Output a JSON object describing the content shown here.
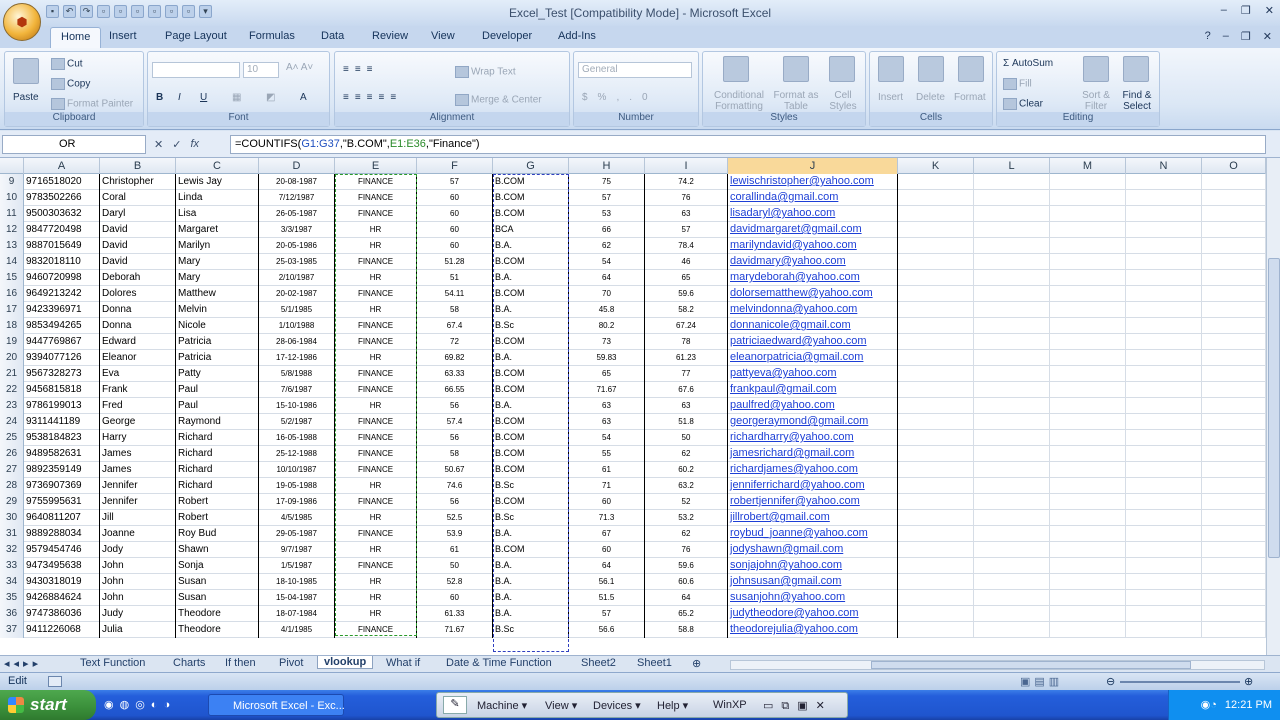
{
  "window": {
    "title": "Excel_Test  [Compatibility Mode] - Microsoft Excel",
    "controls": [
      "–",
      "❐",
      "✕"
    ]
  },
  "ribbon_tabs": [
    "Home",
    "Insert",
    "Page Layout",
    "Formulas",
    "Data",
    "Review",
    "View",
    "Developer",
    "Add-Ins"
  ],
  "ribbon": {
    "clipboard": {
      "paste": "Paste",
      "cut": "Cut",
      "copy": "Copy",
      "format_painter": "Format Painter",
      "label": "Clipboard"
    },
    "font": {
      "font_size": "10",
      "label": "Font"
    },
    "alignment": {
      "wrap": "Wrap Text",
      "merge": "Merge & Center",
      "label": "Alignment"
    },
    "number": {
      "format": "General",
      "label": "Number"
    },
    "styles": {
      "cond": "Conditional Formatting",
      "table": "Format as Table",
      "cell": "Cell Styles",
      "label": "Styles"
    },
    "cells": {
      "insert": "Insert",
      "delete": "Delete",
      "format": "Format",
      "label": "Cells"
    },
    "editing": {
      "autosum": "AutoSum",
      "fill": "Fill",
      "clear": "Clear",
      "sort": "Sort & Filter",
      "find": "Find & Select",
      "label": "Editing"
    }
  },
  "formula_bar": {
    "name_box": "OR",
    "fx": "fx",
    "formula_prefix": "=COUNTIFS(",
    "range1": "G1:G37",
    "crit1": ",\"B.COM\",",
    "range2": "E1:E36",
    "crit2": ",\"Finance\")"
  },
  "columns": [
    "A",
    "B",
    "C",
    "D",
    "E",
    "F",
    "G",
    "H",
    "I",
    "J",
    "K",
    "L",
    "M",
    "N",
    "O"
  ],
  "rows": [
    {
      "n": "9",
      "a": "9716518020",
      "b": "Christopher",
      "c": "Lewis Jay",
      "d": "20-08-1987",
      "e": "FINANCE",
      "f": "57",
      "g": "B.COM",
      "h": "75",
      "i": "74.2",
      "j": "lewischristopher@yahoo.com"
    },
    {
      "n": "10",
      "a": "9783502266",
      "b": "Coral",
      "c": "Linda",
      "d": "7/12/1987",
      "e": "FINANCE",
      "f": "60",
      "g": "B.COM",
      "h": "57",
      "i": "76",
      "j": "corallinda@gmail.com"
    },
    {
      "n": "11",
      "a": "9500303632",
      "b": "Daryl",
      "c": "Lisa",
      "d": "26-05-1987",
      "e": "FINANCE",
      "f": "60",
      "g": "B.COM",
      "h": "53",
      "i": "63",
      "j": "lisadaryl@yahoo.com"
    },
    {
      "n": "12",
      "a": "9847720498",
      "b": "David",
      "c": "Margaret",
      "d": "3/3/1987",
      "e": "HR",
      "f": "60",
      "g": "BCA",
      "h": "66",
      "i": "57",
      "j": "davidmargaret@gmail.com"
    },
    {
      "n": "13",
      "a": "9887015649",
      "b": "David",
      "c": "Marilyn",
      "d": "20-05-1986",
      "e": "HR",
      "f": "60",
      "g": "B.A.",
      "h": "62",
      "i": "78.4",
      "j": "marilyndavid@yahoo.com"
    },
    {
      "n": "14",
      "a": "9832018110",
      "b": "David",
      "c": "Mary",
      "d": "25-03-1985",
      "e": "FINANCE",
      "f": "51.28",
      "g": "B.COM",
      "h": "54",
      "i": "46",
      "j": "davidmary@yahoo.com"
    },
    {
      "n": "15",
      "a": "9460720998",
      "b": "Deborah",
      "c": "Mary",
      "d": "2/10/1987",
      "e": "HR",
      "f": "51",
      "g": "B.A.",
      "h": "64",
      "i": "65",
      "j": "marydeborah@yahoo.com"
    },
    {
      "n": "16",
      "a": "9649213242",
      "b": "Dolores",
      "c": "Matthew",
      "d": "20-02-1987",
      "e": "FINANCE",
      "f": "54.11",
      "g": "B.COM",
      "h": "70",
      "i": "59.6",
      "j": "dolorsematthew@yahoo.com"
    },
    {
      "n": "17",
      "a": "9423396971",
      "b": "Donna",
      "c": "Melvin",
      "d": "5/1/1985",
      "e": "HR",
      "f": "58",
      "g": "B.A.",
      "h": "45.8",
      "i": "58.2",
      "j": "melvindonna@yahoo.com"
    },
    {
      "n": "18",
      "a": "9853494265",
      "b": "Donna",
      "c": "Nicole",
      "d": "1/10/1988",
      "e": "FINANCE",
      "f": "67.4",
      "g": "B.Sc",
      "h": "80.2",
      "i": "67.24",
      "j": "donnanicole@gmail.com"
    },
    {
      "n": "19",
      "a": "9447769867",
      "b": "Edward",
      "c": "Patricia",
      "d": "28-06-1984",
      "e": "FINANCE",
      "f": "72",
      "g": "B.COM",
      "h": "73",
      "i": "78",
      "j": "patriciaedward@yahoo.com"
    },
    {
      "n": "20",
      "a": "9394077126",
      "b": "Eleanor",
      "c": "Patricia",
      "d": "17-12-1986",
      "e": "HR",
      "f": "69.82",
      "g": "B.A.",
      "h": "59.83",
      "i": "61.23",
      "j": "eleanorpatricia@gmail.com"
    },
    {
      "n": "21",
      "a": "9567328273",
      "b": "Eva",
      "c": "Patty",
      "d": "5/8/1988",
      "e": "FINANCE",
      "f": "63.33",
      "g": "B.COM",
      "h": "65",
      "i": "77",
      "j": "pattyeva@yahoo.com"
    },
    {
      "n": "22",
      "a": "9456815818",
      "b": "Frank",
      "c": "Paul",
      "d": "7/6/1987",
      "e": "FINANCE",
      "f": "66.55",
      "g": "B.COM",
      "h": "71.67",
      "i": "67.6",
      "j": "frankpaul@gmail.com"
    },
    {
      "n": "23",
      "a": "9786199013",
      "b": "Fred",
      "c": "Paul",
      "d": "15-10-1986",
      "e": "HR",
      "f": "56",
      "g": "B.A.",
      "h": "63",
      "i": "63",
      "j": "paulfred@yahoo.com"
    },
    {
      "n": "24",
      "a": "9311441189",
      "b": "George",
      "c": "Raymond",
      "d": "5/2/1987",
      "e": "FINANCE",
      "f": "57.4",
      "g": "B.COM",
      "h": "63",
      "i": "51.8",
      "j": "georgeraymond@gmail.com"
    },
    {
      "n": "25",
      "a": "9538184823",
      "b": "Harry",
      "c": "Richard",
      "d": "16-05-1988",
      "e": "FINANCE",
      "f": "56",
      "g": "B.COM",
      "h": "54",
      "i": "50",
      "j": "richardharry@yahoo.com"
    },
    {
      "n": "26",
      "a": "9489582631",
      "b": "James",
      "c": "Richard",
      "d": "25-12-1988",
      "e": "FINANCE",
      "f": "58",
      "g": "B.COM",
      "h": "55",
      "i": "62",
      "j": "jamesrichard@gmail.com"
    },
    {
      "n": "27",
      "a": "9892359149",
      "b": "James",
      "c": "Richard",
      "d": "10/10/1987",
      "e": "FINANCE",
      "f": "50.67",
      "g": "B.COM",
      "h": "61",
      "i": "60.2",
      "j": "richardjames@yahoo.com"
    },
    {
      "n": "28",
      "a": "9736907369",
      "b": "Jennifer",
      "c": "Richard",
      "d": "19-05-1988",
      "e": "HR",
      "f": "74.6",
      "g": "B.Sc",
      "h": "71",
      "i": "63.2",
      "j": "jenniferrichard@yahoo.com"
    },
    {
      "n": "29",
      "a": "9755995631",
      "b": "Jennifer",
      "c": "Robert",
      "d": "17-09-1986",
      "e": "FINANCE",
      "f": "56",
      "g": "B.COM",
      "h": "60",
      "i": "52",
      "j": "robertjennifer@yahoo.com"
    },
    {
      "n": "30",
      "a": "9640811207",
      "b": "Jill",
      "c": "Robert",
      "d": "4/5/1985",
      "e": "HR",
      "f": "52.5",
      "g": "B.Sc",
      "h": "71.3",
      "i": "53.2",
      "j": "jillrobert@gmail.com"
    },
    {
      "n": "31",
      "a": "9889288034",
      "b": "Joanne",
      "c": "Roy Bud",
      "d": "29-05-1987",
      "e": "FINANCE",
      "f": "53.9",
      "g": "B.A.",
      "h": "67",
      "i": "62",
      "j": "roybud_joanne@yahoo.com"
    },
    {
      "n": "32",
      "a": "9579454746",
      "b": "Jody",
      "c": "Shawn",
      "d": "9/7/1987",
      "e": "HR",
      "f": "61",
      "g": "B.COM",
      "h": "60",
      "i": "76",
      "j": "jodyshawn@gmail.com"
    },
    {
      "n": "33",
      "a": "9473495638",
      "b": "John",
      "c": "Sonja",
      "d": "1/5/1987",
      "e": "FINANCE",
      "f": "50",
      "g": "B.A.",
      "h": "64",
      "i": "59.6",
      "j": "sonjajohn@yahoo.com"
    },
    {
      "n": "34",
      "a": "9430318019",
      "b": "John",
      "c": "Susan",
      "d": "18-10-1985",
      "e": "HR",
      "f": "52.8",
      "g": "B.A.",
      "h": "56.1",
      "i": "60.6",
      "j": "johnsusan@gmail.com"
    },
    {
      "n": "35",
      "a": "9426884624",
      "b": "John",
      "c": "Susan",
      "d": "15-04-1987",
      "e": "HR",
      "f": "60",
      "g": "B.A.",
      "h": "51.5",
      "i": "64",
      "j": "susanjohn@yahoo.com"
    },
    {
      "n": "36",
      "a": "9747386036",
      "b": "Judy",
      "c": "Theodore",
      "d": "18-07-1984",
      "e": "HR",
      "f": "61.33",
      "g": "B.A.",
      "h": "57",
      "i": "65.2",
      "j": "judytheodore@yahoo.com"
    },
    {
      "n": "37",
      "a": "9411226068",
      "b": "Julia",
      "c": "Theodore",
      "d": "4/1/1985",
      "e": "FINANCE",
      "f": "71.67",
      "g": "B.Sc",
      "h": "56.6",
      "i": "58.8",
      "j": "theodorejulia@yahoo.com"
    }
  ],
  "sheet_tabs": [
    "Text Function",
    "Charts",
    "If then",
    "Pivot",
    "vlookup",
    "What if",
    "Date & Time Function",
    "Sheet2",
    "Sheet1"
  ],
  "active_sheet": "vlookup",
  "status": {
    "mode": "Edit"
  },
  "taskbar": {
    "start": "start",
    "task": "Microsoft Excel - Exc...",
    "machine": "Machine",
    "view": "View",
    "devices": "Devices",
    "help": "Help",
    "vm": "WinXP",
    "clock": "12:21 PM"
  },
  "colors": {
    "accent": "#245edb",
    "link": "#1d3fd6",
    "range_g": "#3040c0",
    "range_e": "#2a9a2a",
    "selected_col": "#f9d99a"
  }
}
